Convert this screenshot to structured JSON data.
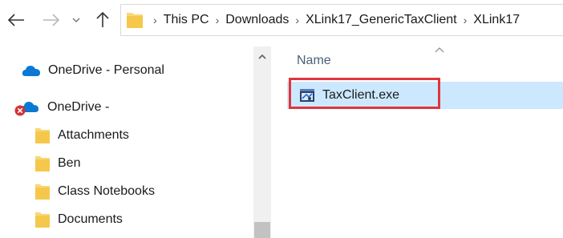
{
  "breadcrumbs": [
    "This PC",
    "Downloads",
    "XLink17_GenericTaxClient",
    "XLink17"
  ],
  "nav_tree": {
    "onedrive_personal": "OneDrive - Personal",
    "onedrive_work": "OneDrive -",
    "folders": [
      "Attachments",
      "Ben",
      "Class Notebooks",
      "Documents"
    ]
  },
  "file_list": {
    "column_name": "Name",
    "items": [
      {
        "name": "TaxClient.exe",
        "selected": true,
        "highlighted": true
      }
    ]
  },
  "icons": {
    "back": "back-arrow-icon",
    "forward": "forward-arrow-icon",
    "recent": "chevron-down-icon",
    "up": "up-arrow-icon",
    "folder": "folder-icon",
    "cloud": "onedrive-cloud-icon",
    "error": "error-x-icon",
    "exe": "application-exe-icon"
  },
  "colors": {
    "selection": "#cce8ff",
    "highlight_border": "#e0353e",
    "folder_yellow": "#f8d775",
    "onedrive_blue": "#0a78d4",
    "error_red": "#d13438"
  }
}
